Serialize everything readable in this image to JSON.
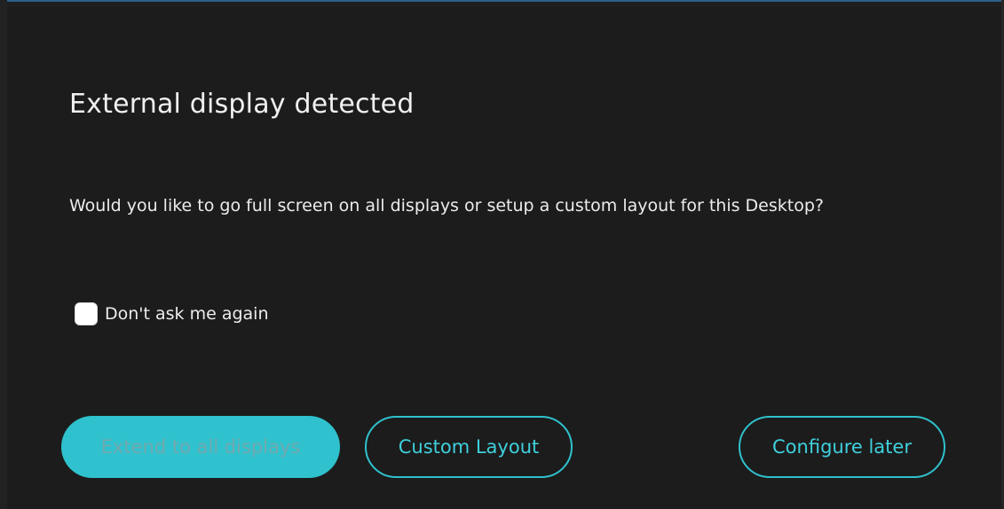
{
  "dialog": {
    "title": "External display detected",
    "message": "Would you like to go full screen on all displays or setup a custom layout for this Desktop?",
    "checkbox": {
      "label": "Don't ask me again",
      "checked": false
    },
    "buttons": {
      "extend": "Extend to all displays",
      "custom": "Custom Layout",
      "later": "Configure later"
    }
  },
  "colors": {
    "background": "#1c1c1c",
    "accent": "#2fc1cd",
    "text": "#ececec"
  }
}
